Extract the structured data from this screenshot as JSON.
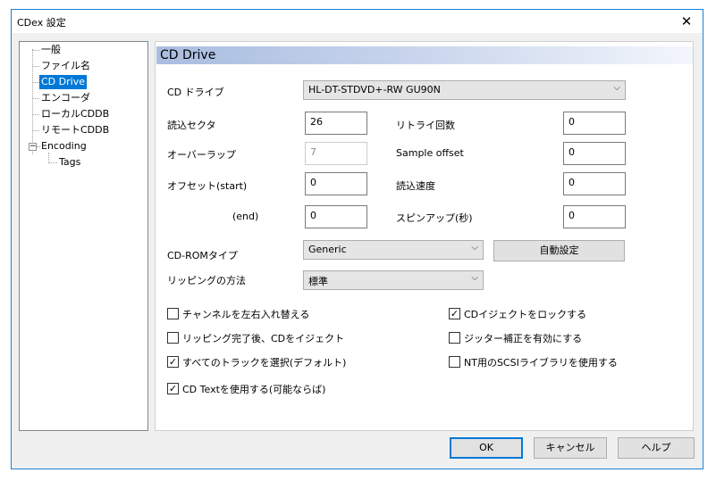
{
  "window": {
    "title": "CDex 設定",
    "close_glyph": "✕"
  },
  "tree": {
    "items": [
      {
        "label": "一般"
      },
      {
        "label": "ファイル名"
      },
      {
        "label": "CD Drive"
      },
      {
        "label": "エンコーダ"
      },
      {
        "label": "ローカルCDDB"
      },
      {
        "label": "リモートCDDB"
      },
      {
        "label": "Encoding"
      },
      {
        "label": "Tags"
      }
    ],
    "selected": "CD Drive",
    "expander_glyph": "−"
  },
  "panel": {
    "header": "CD Drive",
    "cd_drive_label": "CD ドライブ",
    "cd_drive_value": "HL-DT-STDVD+-RW GU90N",
    "read_sectors_label": "読込セクタ",
    "read_sectors_value": "26",
    "retry_label": "リトライ回数",
    "retry_value": "0",
    "overlap_label": "オーバーラップ",
    "overlap_value": "7",
    "sample_offset_label": "Sample offset",
    "sample_offset_value": "0",
    "offset_start_label": "オフセット(start)",
    "offset_start_value": "0",
    "read_speed_label": "読込速度",
    "read_speed_value": "0",
    "offset_end_label": "(end)",
    "offset_end_value": "0",
    "spinup_label": "スピンアップ(秒)",
    "spinup_value": "0",
    "cdrom_type_label": "CD-ROMタイプ",
    "cdrom_type_value": "Generic",
    "auto_config_label": "自動設定",
    "ripping_method_label": "リッピングの方法",
    "ripping_method_value": "標準",
    "chevron_glyph": "⌵",
    "check_glyph": "✓",
    "checkboxes": {
      "swap_channels": {
        "label": "チャンネルを左右入れ替える",
        "checked": false
      },
      "eject_after": {
        "label": "リッピング完了後、CDをイジェクト",
        "checked": false
      },
      "select_all_tracks": {
        "label": "すべてのトラックを選択(デフォルト)",
        "checked": true
      },
      "use_cd_text": {
        "label": "CD Textを使用する(可能ならば)",
        "checked": true
      },
      "lock_eject": {
        "label": "CDイジェクトをロックする",
        "checked": true
      },
      "jitter_correction": {
        "label": "ジッター補正を有効にする",
        "checked": false
      },
      "nt_scsi": {
        "label": "NT用のSCSIライブラリを使用する",
        "checked": false
      }
    }
  },
  "buttons": {
    "ok": "OK",
    "cancel": "キャンセル",
    "help": "ヘルプ"
  }
}
